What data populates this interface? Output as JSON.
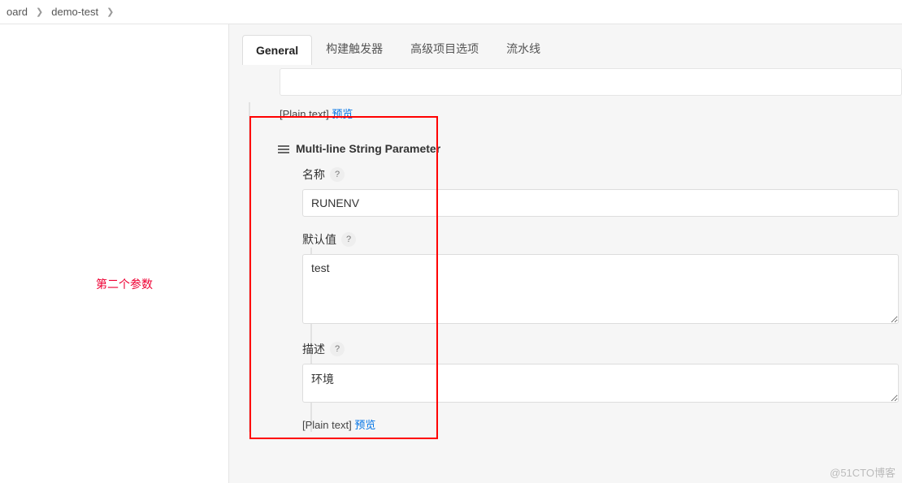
{
  "breadcrumb": {
    "items": [
      "oard",
      "demo-test"
    ]
  },
  "annotation": "第二个参数",
  "tabs": [
    {
      "label": "General",
      "active": true
    },
    {
      "label": "构建触发器",
      "active": false
    },
    {
      "label": "高级项目选项",
      "active": false
    },
    {
      "label": "流水线",
      "active": false
    }
  ],
  "preview": {
    "prefix": "[Plain text] ",
    "link": "预览"
  },
  "section": {
    "title": "Multi-line String Parameter",
    "fields": {
      "name": {
        "label": "名称",
        "value": "RUNENV"
      },
      "default": {
        "label": "默认值",
        "value": "test"
      },
      "desc": {
        "label": "描述",
        "value": "环境"
      }
    }
  },
  "watermark": "@51CTO博客"
}
